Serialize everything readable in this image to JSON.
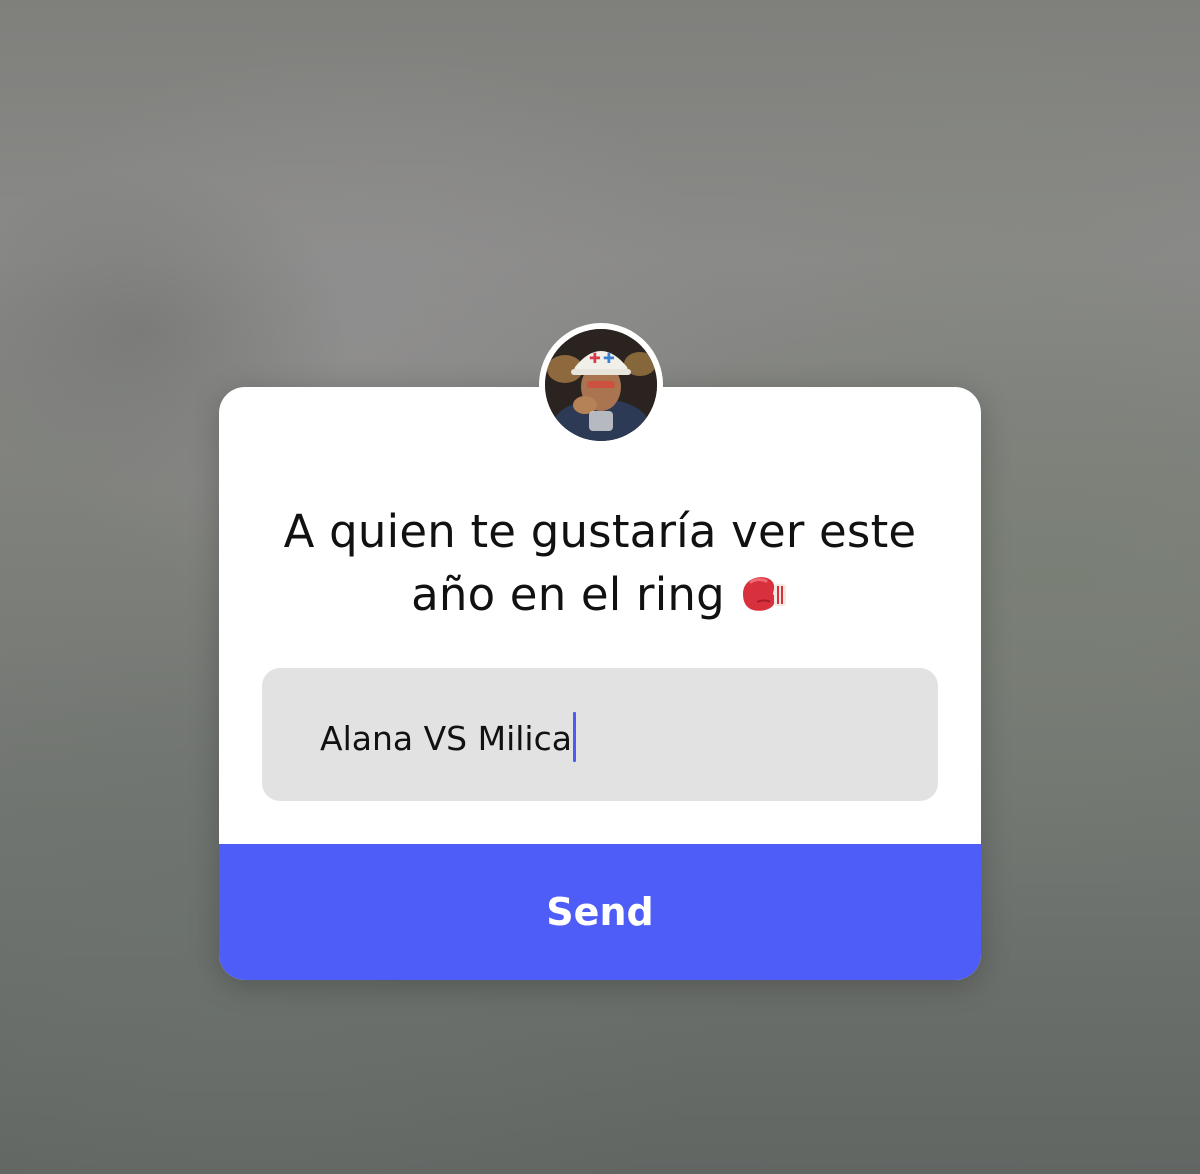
{
  "question": {
    "line1": "A quien te gustaría ver este",
    "line2": "año en el ring",
    "emoji": "boxing-glove-icon"
  },
  "answer": {
    "value": "Alana VS Milica"
  },
  "send_button": {
    "label": "Send"
  },
  "avatar": {
    "icon": "profile-avatar"
  },
  "colors": {
    "accent": "#4e5df7",
    "card": "#ffffff",
    "input_bg": "#e2e2e2",
    "caret": "#4a5cf4"
  }
}
